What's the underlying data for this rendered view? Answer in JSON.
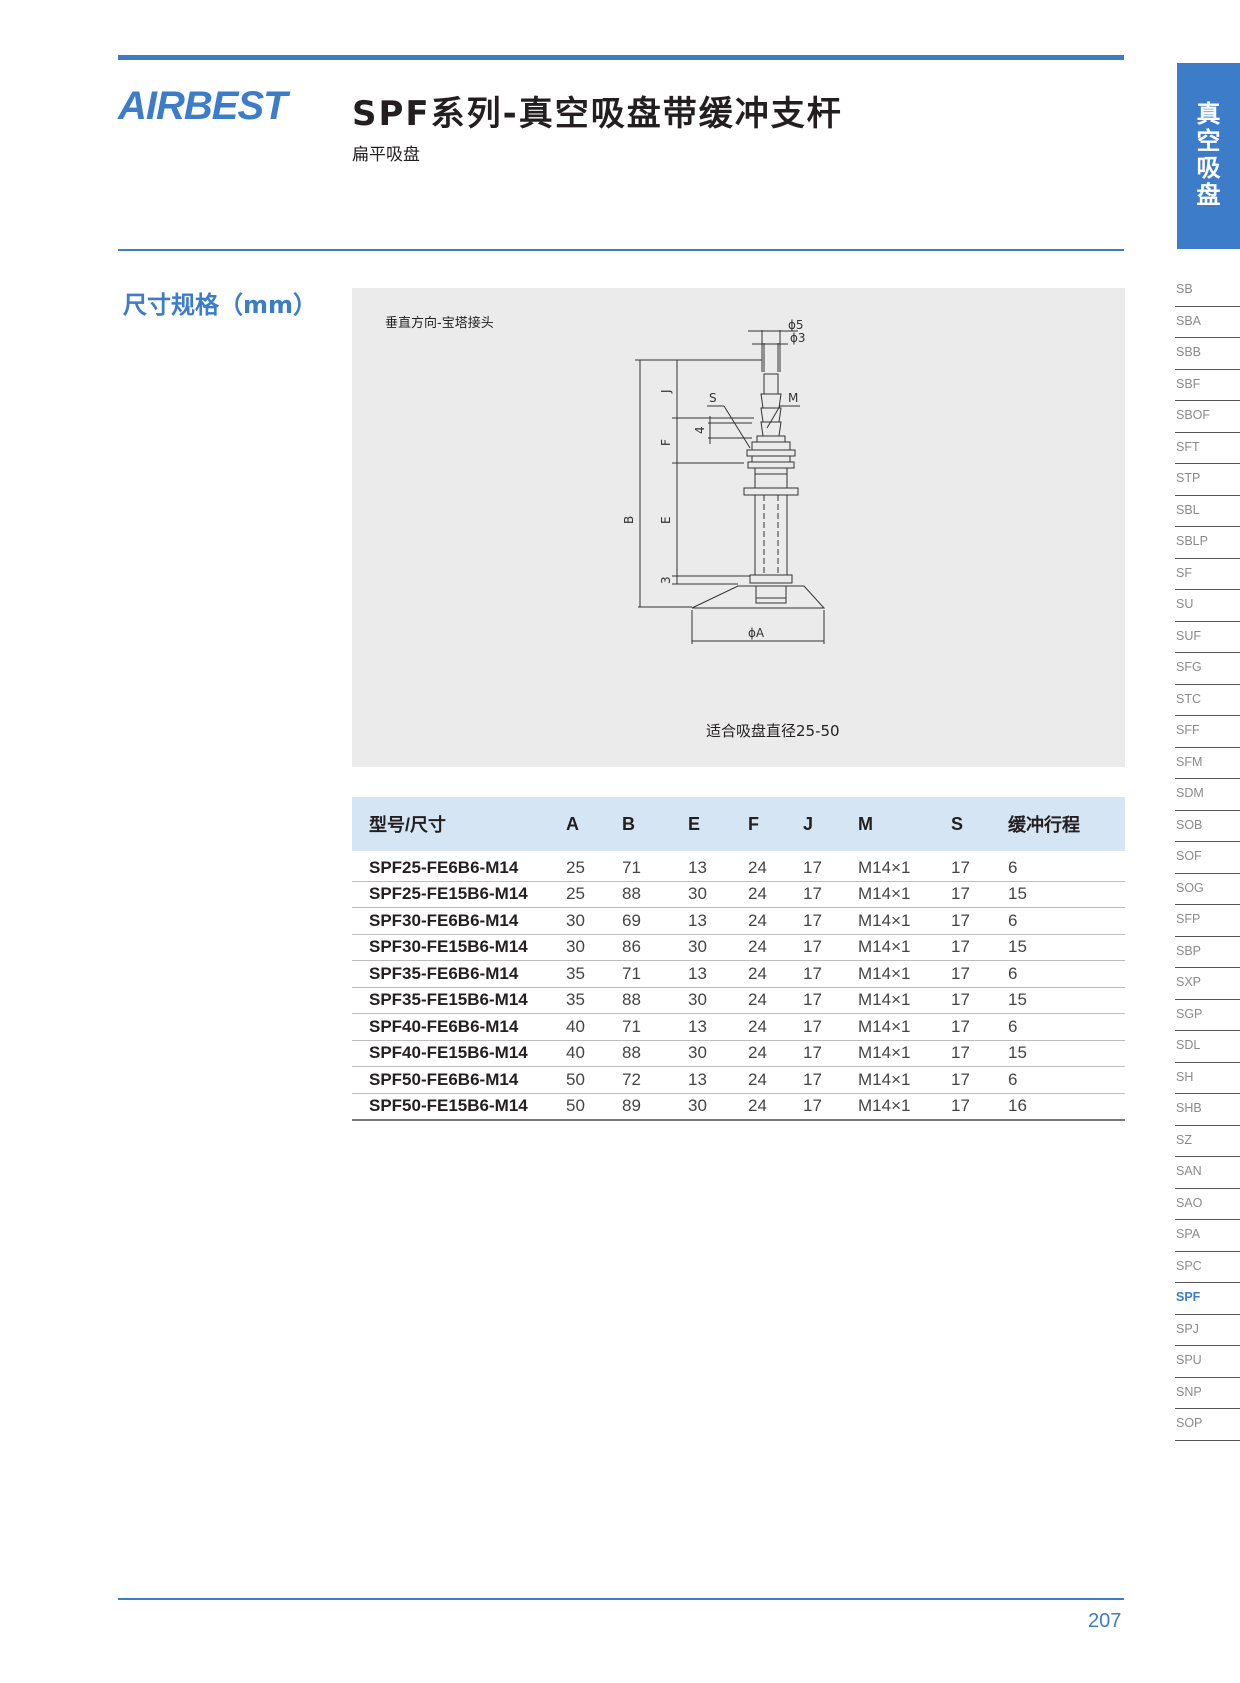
{
  "brand": {
    "logo": "AIRBEST",
    "accent": "#3d7cc9"
  },
  "header": {
    "title": "SPF系列-真空吸盘带缓冲支杆",
    "subtitle": "扁平吸盘"
  },
  "side_tab": {
    "chars": [
      "真",
      "空",
      "吸",
      "盘"
    ]
  },
  "side_nav": [
    "SB",
    "SBA",
    "SBB",
    "SBF",
    "SBOF",
    "SFT",
    "STP",
    "SBL",
    "SBLP",
    "SF",
    "SU",
    "SUF",
    "SFG",
    "STC",
    "SFF",
    "SFM",
    "SDM",
    "SOB",
    "SOF",
    "SOG",
    "SFP",
    "SBP",
    "SXP",
    "SGP",
    "SDL",
    "SH",
    "SHB",
    "SZ",
    "SAN",
    "SAO",
    "SPA",
    "SPC",
    "SPF",
    "SPJ",
    "SPU",
    "SNP",
    "SOP"
  ],
  "side_nav_active": "SPF",
  "section": {
    "title": "尺寸规格（mm）"
  },
  "diagram": {
    "label": "垂直方向-宝塔接头",
    "caption": "适合吸盘直径25-50",
    "dims": {
      "phi5": "ϕ5",
      "phi3": "ϕ3",
      "phiA": "ϕA",
      "S": "S",
      "M": "M",
      "J": "J",
      "F": "F",
      "B": "B",
      "E": "E",
      "four": "4",
      "three": "3"
    }
  },
  "table": {
    "headers": [
      "型号/尺寸",
      "A",
      "B",
      "E",
      "F",
      "J",
      "M",
      "S",
      "缓冲行程"
    ],
    "rows": [
      [
        "SPF25-FE6B6-M14",
        "25",
        "71",
        "13",
        "24",
        "17",
        "M14×1",
        "17",
        "6"
      ],
      [
        "SPF25-FE15B6-M14",
        "25",
        "88",
        "30",
        "24",
        "17",
        "M14×1",
        "17",
        "15"
      ],
      [
        "SPF30-FE6B6-M14",
        "30",
        "69",
        "13",
        "24",
        "17",
        "M14×1",
        "17",
        "6"
      ],
      [
        "SPF30-FE15B6-M14",
        "30",
        "86",
        "30",
        "24",
        "17",
        "M14×1",
        "17",
        "15"
      ],
      [
        "SPF35-FE6B6-M14",
        "35",
        "71",
        "13",
        "24",
        "17",
        "M14×1",
        "17",
        "6"
      ],
      [
        "SPF35-FE15B6-M14",
        "35",
        "88",
        "30",
        "24",
        "17",
        "M14×1",
        "17",
        "15"
      ],
      [
        "SPF40-FE6B6-M14",
        "40",
        "71",
        "13",
        "24",
        "17",
        "M14×1",
        "17",
        "6"
      ],
      [
        "SPF40-FE15B6-M14",
        "40",
        "88",
        "30",
        "24",
        "17",
        "M14×1",
        "17",
        "15"
      ],
      [
        "SPF50-FE6B6-M14",
        "50",
        "72",
        "13",
        "24",
        "17",
        "M14×1",
        "17",
        "6"
      ],
      [
        "SPF50-FE15B6-M14",
        "50",
        "89",
        "30",
        "24",
        "17",
        "M14×1",
        "17",
        "16"
      ]
    ]
  },
  "footer": {
    "page_number": "207"
  }
}
